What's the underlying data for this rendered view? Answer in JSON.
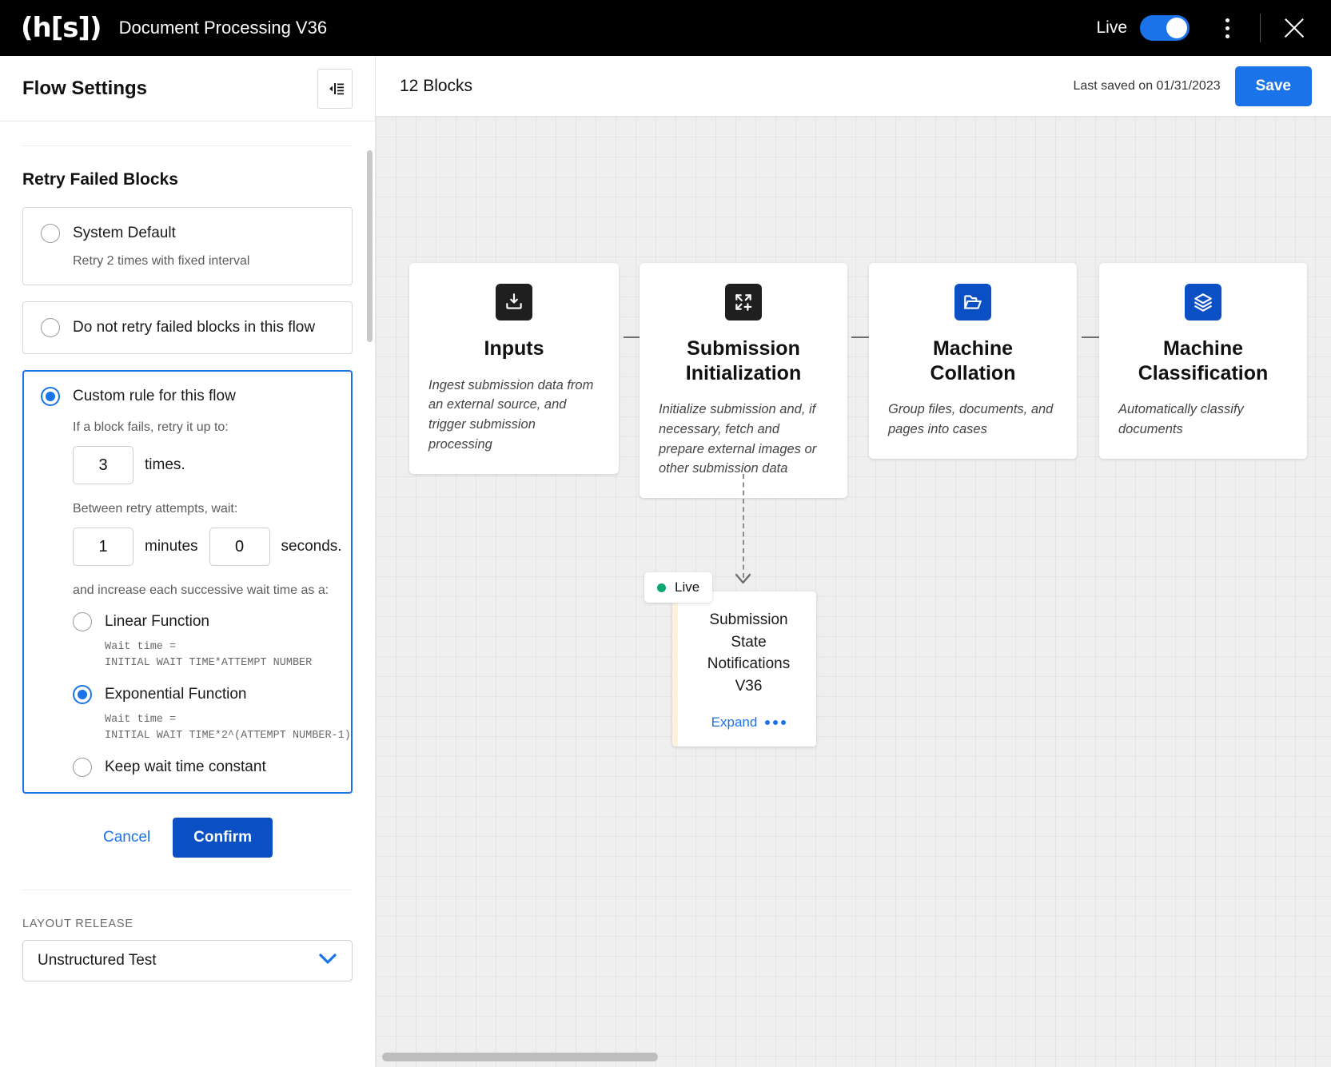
{
  "topbar": {
    "logo": "(h[s])",
    "app_title": "Document Processing V36",
    "live_label": "Live",
    "live_on": true,
    "menu_icon": "kebab-menu-icon",
    "close_icon": "close-icon",
    "accent": "#1a73e8"
  },
  "sidebar": {
    "title": "Flow Settings",
    "collapse_icon": "panel-collapse-icon",
    "section_title": "Retry Failed Blocks",
    "options": [
      {
        "label": "System Default",
        "sub": "Retry 2 times with fixed interval",
        "selected": false
      },
      {
        "label": "Do not retry failed blocks in this flow",
        "sub": "",
        "selected": false
      },
      {
        "label": "Custom rule for this flow",
        "sub": "",
        "selected": true
      }
    ],
    "custom": {
      "retry_prompt": "If a block fails, retry it up to:",
      "times_value": "3",
      "times_unit": "times.",
      "wait_prompt": "Between retry attempts, wait:",
      "minutes_value": "1",
      "minutes_unit": "minutes",
      "seconds_value": "0",
      "seconds_unit": "seconds.",
      "increase_prompt": "and increase each successive wait time as a:",
      "functions": [
        {
          "label": "Linear Function",
          "formula": "Wait time =\nINITIAL WAIT TIME*ATTEMPT NUMBER",
          "selected": false
        },
        {
          "label": "Exponential Function",
          "formula": "Wait time =\nINITIAL WAIT TIME*2^(ATTEMPT NUMBER-1)",
          "selected": true
        },
        {
          "label": "Keep wait time constant",
          "formula": "",
          "selected": false
        }
      ]
    },
    "cancel_label": "Cancel",
    "confirm_label": "Confirm",
    "layout_release_label": "LAYOUT RELEASE",
    "layout_release_value": "Unstructured Test",
    "chevron_icon": "chevron-down-icon"
  },
  "canvas_toolbar": {
    "blocks_count": "12 Blocks",
    "last_saved": "Last saved on 01/31/2023",
    "save_label": "Save"
  },
  "flow": {
    "nodes": [
      {
        "title": "Inputs",
        "desc": "Ingest submission data from an external source, and trigger submission processing",
        "icon": "download-tray-icon",
        "icon_style": "dark"
      },
      {
        "title": "Submission Initialization",
        "desc": "Initialize submission and, if necessary, fetch and prepare external images or other submission data",
        "icon": "expand-plus-icon",
        "icon_style": "dark"
      },
      {
        "title": "Machine Collation",
        "desc": "Group files, documents, and pages into cases",
        "icon": "folder-open-icon",
        "icon_style": "blue"
      },
      {
        "title": "Machine Classification",
        "desc": "Automatically classify documents",
        "icon": "layers-stack-icon",
        "icon_style": "blue"
      }
    ],
    "note": {
      "badge_label": "Live",
      "badge_dot_color": "#0aa676",
      "title": "Submission State Notifications V36",
      "expand_label": "Expand",
      "expand_icon": "ellipsis-icon"
    }
  }
}
